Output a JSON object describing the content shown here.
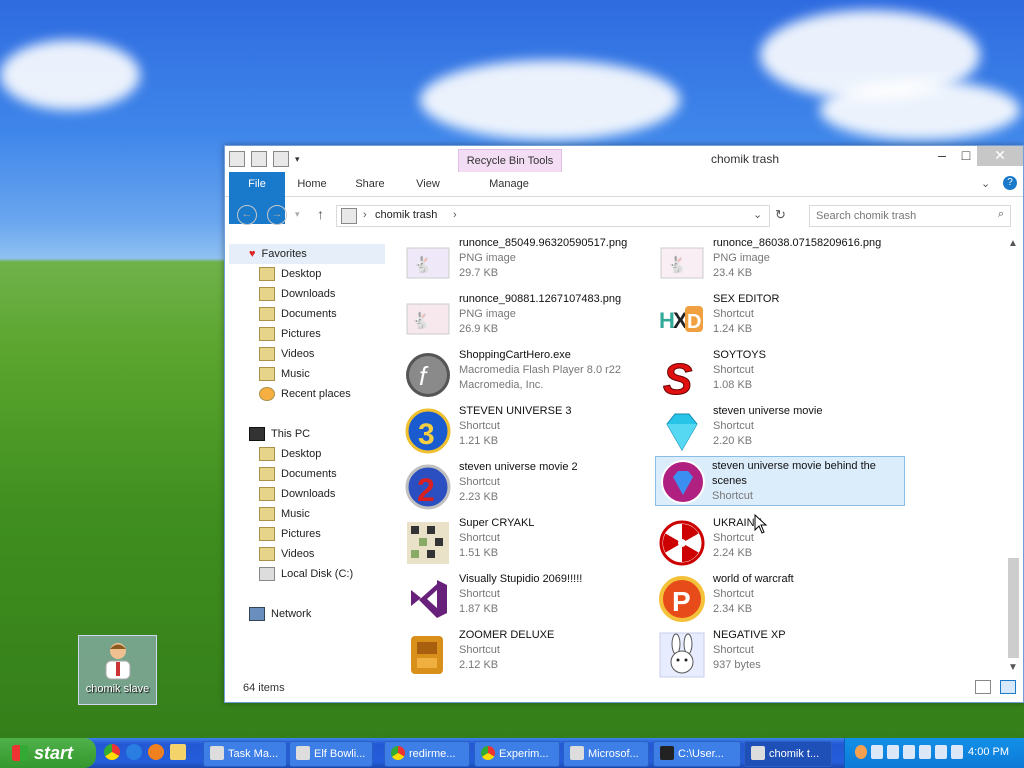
{
  "desktop": {
    "icon_label": "chomik slave"
  },
  "window": {
    "title": "chomik trash",
    "contextual_tab": "Recycle Bin Tools",
    "ribbon_tabs": [
      "File",
      "Home",
      "Share",
      "View",
      "Manage"
    ],
    "address": {
      "crumb": "chomik trash"
    },
    "search_placeholder": "Search chomik trash",
    "nav": {
      "favorites": "Favorites",
      "favorites_items": [
        "Desktop",
        "Downloads",
        "Documents",
        "Pictures",
        "Videos",
        "Music",
        "Recent places"
      ],
      "this_pc": "This PC",
      "pc_items": [
        "Desktop",
        "Documents",
        "Downloads",
        "Music",
        "Pictures",
        "Videos",
        "Local Disk (C:)"
      ],
      "network": "Network"
    },
    "files": [
      {
        "name": "runonce_85049.96320590517.png",
        "type": "PNG image",
        "size": "29.7 KB",
        "icon": "png-thumb-icon"
      },
      {
        "name": "runonce_86038.07158209616.png",
        "type": "PNG image",
        "size": "23.4 KB",
        "icon": "png-thumb-icon"
      },
      {
        "name": "runonce_90881.1267107483.png",
        "type": "PNG image",
        "size": "26.9 KB",
        "icon": "png-thumb-icon"
      },
      {
        "name": "SEX EDITOR",
        "type": "Shortcut",
        "size": "1.24 KB",
        "icon": "hxd-icon"
      },
      {
        "name": "ShoppingCartHero.exe",
        "type": "Macromedia Flash Player 8.0  r22",
        "size": "Macromedia, Inc.",
        "icon": "flash-icon"
      },
      {
        "name": "SOYTOYS",
        "type": "Shortcut",
        "size": "1.08 KB",
        "icon": "red-s-icon"
      },
      {
        "name": "STEVEN UNIVERSE 3",
        "type": "Shortcut",
        "size": "1.21 KB",
        "icon": "bejeweled3-icon"
      },
      {
        "name": "steven universe movie",
        "type": "Shortcut",
        "size": "2.20 KB",
        "icon": "diamond-icon"
      },
      {
        "name": "steven universe movie 2",
        "type": "Shortcut",
        "size": "2.23 KB",
        "icon": "bejeweled2-icon"
      },
      {
        "name": "steven universe movie behind the scenes",
        "type": "Shortcut",
        "size": "",
        "icon": "gem-twist-icon"
      },
      {
        "name": "Super CRYAKL",
        "type": "Shortcut",
        "size": "1.51 KB",
        "icon": "pixel-icon"
      },
      {
        "name": "UKRAINE",
        "type": "Shortcut",
        "size": "2.24 KB",
        "icon": "radiation-icon"
      },
      {
        "name": "Visually Stupidio 2069!!!!!",
        "type": "Shortcut",
        "size": "1.87 KB",
        "icon": "visual-studio-icon"
      },
      {
        "name": "world of warcraft",
        "type": "Shortcut",
        "size": "2.34 KB",
        "icon": "p-logo-icon"
      },
      {
        "name": "ZOOMER DELUXE",
        "type": "Shortcut",
        "size": "2.12 KB",
        "icon": "zuma-icon"
      },
      {
        "name": "NEGATIVE XP",
        "type": "Shortcut",
        "size": "937 bytes",
        "icon": "bunny-icon"
      }
    ],
    "status": "64 items"
  },
  "taskbar": {
    "start_label": "start",
    "buttons": [
      "Task Ma...",
      "Elf Bowli...",
      "redirme...",
      "Experim...",
      "Microsof...",
      "C:\\User...",
      "chomik t..."
    ],
    "clock": "4:00 PM"
  },
  "colors": {
    "ribbon_file": "#1979ca",
    "context_tab": "#f3ddf5",
    "taskbar": "#245edb",
    "start": "#33982d",
    "selection": "#dbecfb"
  }
}
